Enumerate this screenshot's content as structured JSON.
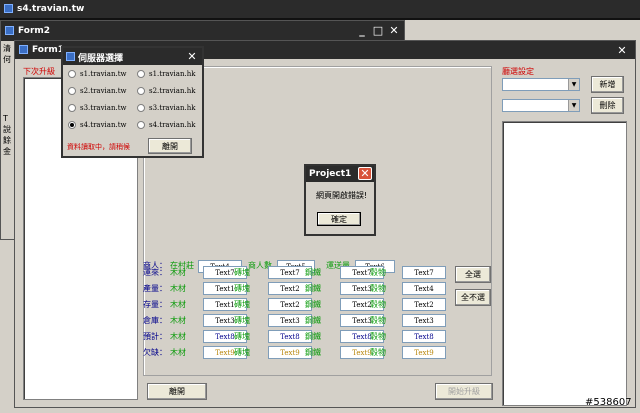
{
  "browser": {
    "title": "s4.travian.tw"
  },
  "form2": {
    "title": "Form2",
    "min": "_",
    "max": "□",
    "close": "✕",
    "side_chars": [
      "清",
      "何",
      "T",
      "說",
      "餘",
      "金"
    ]
  },
  "form1": {
    "title": "Form1",
    "close": "✕",
    "upgrade_label": "下次升級",
    "building_label": "廳選設定",
    "add_button": "新增",
    "delete_button": "刪除",
    "close_button": "離開",
    "start_button": "開始升級",
    "select_all": "全選",
    "deselect_all": "全不選",
    "merchants": {
      "label": "商人：",
      "in_village_label": "在村莊",
      "in_village_value": "Text4",
      "count_label": "商人數",
      "count_value": "Text5",
      "capacity_label": "運送量",
      "capacity_value": "Text6"
    },
    "resource_names": [
      "木材",
      "磚塊",
      "鋼鐵",
      "穀物"
    ],
    "rows": [
      {
        "label": "運來：",
        "label_color": "#00008b",
        "res_color": "#0a9b0a",
        "val_color": "#000000",
        "values": [
          "Text7",
          "Text7",
          "Text7",
          "Text7"
        ]
      },
      {
        "label": "產量：",
        "label_color": "#00008b",
        "res_color": "#0a9b0a",
        "val_color": "#000000",
        "values": [
          "Text1",
          "Text2",
          "Text3",
          "Text4"
        ]
      },
      {
        "label": "存量：",
        "label_color": "#00008b",
        "res_color": "#0a9b0a",
        "val_color": "#000000",
        "values": [
          "Text1",
          "Text2",
          "Text2",
          "Text2"
        ]
      },
      {
        "label": "倉庫：",
        "label_color": "#00008b",
        "res_color": "#0a9b0a",
        "val_color": "#000000",
        "values": [
          "Text3",
          "Text3",
          "Text3",
          "Text3"
        ]
      },
      {
        "label": "預計：",
        "label_color": "#00008b",
        "res_color": "#0a9b0a",
        "val_color": "#00008b",
        "values": [
          "Text8",
          "Text8",
          "Text8",
          "Text8"
        ]
      },
      {
        "label": "欠缺：",
        "label_color": "#00008b",
        "res_color": "#0a9b0a",
        "val_color": "#b8860b",
        "values": [
          "Text9",
          "Text9",
          "Text9",
          "Text9"
        ]
      }
    ]
  },
  "server_dialog": {
    "title": "伺服器選擇",
    "close": "✕",
    "servers": [
      {
        "label": "s1.travian.tw",
        "checked": false
      },
      {
        "label": "s1.travian.hk",
        "checked": false
      },
      {
        "label": "s2.travian.tw",
        "checked": false
      },
      {
        "label": "s2.travian.hk",
        "checked": false
      },
      {
        "label": "s3.travian.tw",
        "checked": false
      },
      {
        "label": "s3.travian.hk",
        "checked": false
      },
      {
        "label": "s4.travian.tw",
        "checked": true
      },
      {
        "label": "s4.travian.hk",
        "checked": false
      }
    ],
    "status": "資料讀取中，請稍候",
    "exit_button": "離開"
  },
  "error_dialog": {
    "title": "Project1",
    "close": "✕",
    "message": "網頁開啟錯誤!",
    "ok_button": "確定"
  },
  "watermark": "#538607",
  "colors": {
    "titlebar": "#2b2b2b",
    "error_close": "#d9533a"
  }
}
